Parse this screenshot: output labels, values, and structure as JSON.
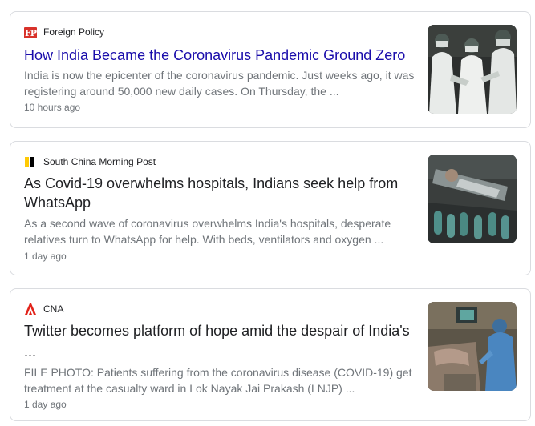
{
  "articles": [
    {
      "source": "Foreign Policy",
      "source_logo": "foreign-policy-logo",
      "source_logo_text": "FP",
      "headline": "How India Became the Coronavirus Pandemic Ground Zero",
      "snippet_line1": "India is now the epicenter of the coronavirus pandemic. Just weeks ago, it was",
      "snippet_line2": "registering around 50,000 new daily cases. On Thursday, the ...",
      "time": "10 hours ago",
      "thumbnail": "health-workers-in-ppe-photo"
    },
    {
      "source": "South China Morning Post",
      "source_logo": "scmp-logo",
      "headline_line1": "As Covid-19 overwhelms hospitals, Indians seek help from",
      "headline_line2": "WhatsApp",
      "snippet_line1": "As a second wave of coronavirus overwhelms India's hospitals, desperate",
      "snippet_line2": "relatives turn to WhatsApp for help. With beds, ventilators and oxygen ...",
      "time": "1 day ago",
      "thumbnail": "patients-on-oxygen-photo"
    },
    {
      "source": "CNA",
      "source_logo": "cna-logo",
      "headline_line1": "Twitter becomes platform of hope amid the despair of India's",
      "headline_line2": "...",
      "snippet_line1": "FILE PHOTO: Patients suffering from the coronavirus disease (COVID-19) get",
      "snippet_line2": "treatment at the casualty ward in Lok Nayak Jai Prakash (LNJP) ...",
      "time": "1 day ago",
      "thumbnail": "casualty-ward-photo"
    }
  ],
  "colors": {
    "link_blue": "#1a0dab",
    "title_black": "#202124",
    "meta_gray": "#70757a",
    "card_border": "#dadce0",
    "fp_red": "#d8322a",
    "scmp_yellow": "#ffca05",
    "cna_red": "#e2231a"
  }
}
